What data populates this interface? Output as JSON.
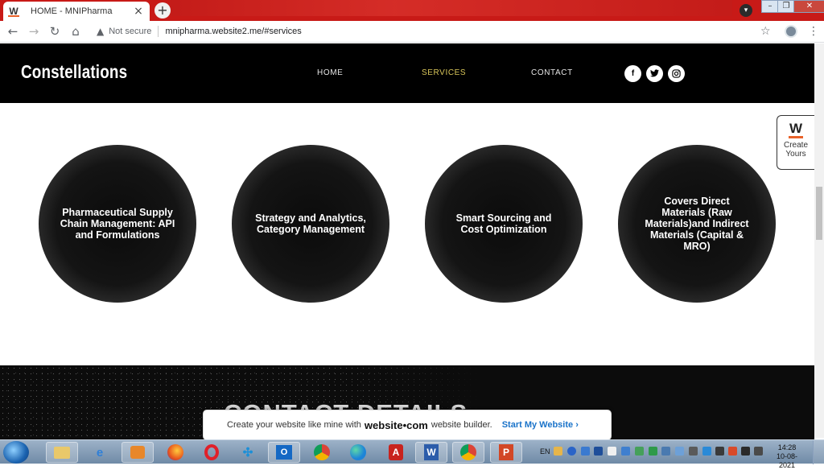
{
  "browser": {
    "tab_title": "HOME - MNIPharma",
    "tab_favicon": "W",
    "tab_close": "×",
    "new_tab": "+",
    "security_label": "Not secure",
    "url": "mnipharma.website2.me/#services"
  },
  "site": {
    "logo": "Constellations",
    "nav": [
      {
        "label": "HOME",
        "active": false
      },
      {
        "label": "SERVICES",
        "active": true
      },
      {
        "label": "CONTACT",
        "active": false
      }
    ],
    "social": [
      {
        "icon": "facebook-icon",
        "glyph": "f"
      },
      {
        "icon": "twitter-icon",
        "glyph": "t"
      },
      {
        "icon": "instagram-icon",
        "glyph": "◎"
      }
    ],
    "accent_color": "#d9c65a"
  },
  "create_widget": {
    "logo": "W",
    "line1": "Create",
    "line2": "Yours"
  },
  "services": [
    "Pharmaceutical Supply Chain Management: API and Formulations",
    "Strategy and Analytics, Category Management",
    "Smart Sourcing and Cost Optimization",
    "Covers Direct Materials (Raw Materials)and Indirect Materials (Capital & MRO)"
  ],
  "contact": {
    "title": "CONTACT DETAILS"
  },
  "promo": {
    "text_before": "Create your website like mine with",
    "brand": "website•com",
    "text_after": "website builder.",
    "cta": "Start My Website ›"
  },
  "taskbar": {
    "language": "EN",
    "time": "14:28",
    "date": "10-08-2021"
  }
}
